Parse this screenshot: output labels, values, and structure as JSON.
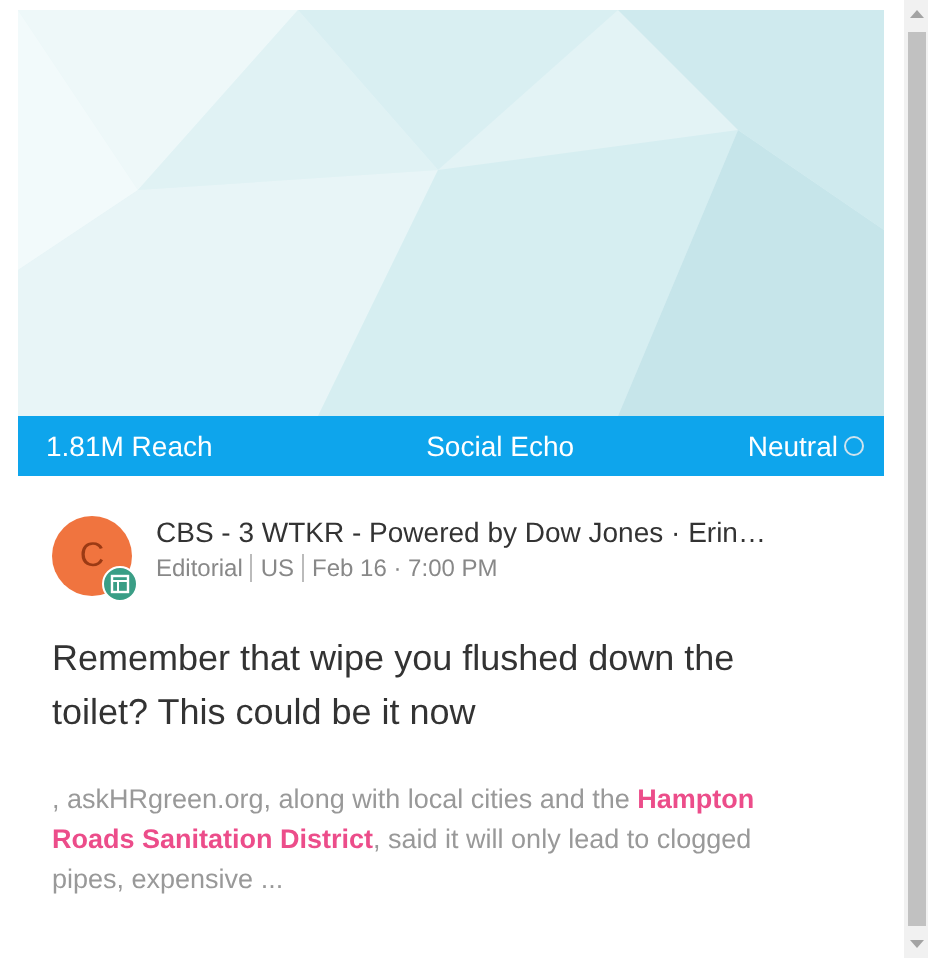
{
  "card": {
    "stats_bar": {
      "reach": "1.81M Reach",
      "source_type": "Social Echo",
      "sentiment": "Neutral"
    },
    "author": {
      "avatar_letter": "C",
      "byline": "CBS - 3 WTKR - Powered by Dow Jones · Erin…",
      "meta": [
        "Editorial",
        "US",
        "Feb 16 · 7:00 PM"
      ]
    },
    "headline": "Remember that wipe you flushed down the toilet? This could be it now",
    "snippet": ", askHRgreen.org, along with local cities and the **Hampton Roads Sanitation District**, said it will only lead to clogged pipes, expensive ..."
  }
}
